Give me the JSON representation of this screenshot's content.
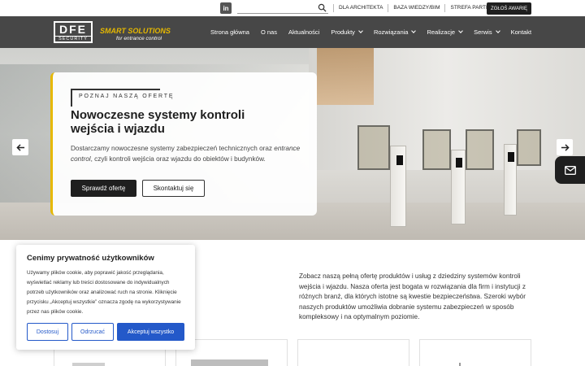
{
  "topbar": {
    "linkedin_label": "in",
    "search_placeholder": "",
    "links": [
      "DLA ARCHITEKTA",
      "BAZA WIEDZY/BIM",
      "STREFA PARTNERA"
    ],
    "report_button": "ZGŁOŚ AWARIĘ"
  },
  "header": {
    "logo_main": "DFE",
    "logo_sub": "SECURITY",
    "tagline_main": "SMART SOLUTIONS",
    "tagline_sub": "for entrance control",
    "menu": [
      {
        "label": "Strona główna",
        "dropdown": false
      },
      {
        "label": "O nas",
        "dropdown": false
      },
      {
        "label": "Aktualności",
        "dropdown": false
      },
      {
        "label": "Produkty",
        "dropdown": true
      },
      {
        "label": "Rozwiązania",
        "dropdown": true
      },
      {
        "label": "Realizacje",
        "dropdown": true
      },
      {
        "label": "Serwis",
        "dropdown": true
      },
      {
        "label": "Kontakt",
        "dropdown": false
      }
    ]
  },
  "hero": {
    "eyebrow": "POZNAJ NASZĄ OFERTĘ",
    "title": "Nowoczesne systemy kontroli wejścia i wjazdu",
    "desc_before": "Dostarczamy nowoczesne systemy zabezpieczeń technicznych oraz ",
    "desc_italic": "entrance control",
    "desc_after": ", czyli kontroli wejścia oraz wjazdu do obiektów i budynków.",
    "primary_button": "Sprawdź ofertę",
    "secondary_button": "Skontaktuj się"
  },
  "offer": {
    "text": "Zobacz naszą pełną ofertę produktów i usług z dziedziny systemów kontroli wejścia i wjazdu. Nasza oferta jest bogata w rozwiązania dla firm i instytucji z różnych branż, dla których istotne są kwestie bezpieczeństwa. Szeroki wybór naszych produktów umożliwia dobranie systemu zabezpieczeń w sposób kompleksowy i na optymalnym poziomie."
  },
  "cookie": {
    "title": "Cenimy prywatność użytkowników",
    "text": "Używamy plików cookie, aby poprawić jakość przeglądania, wyświetlać reklamy lub treści dostosowane do indywidualnych potrzeb użytkowników oraz analizować ruch na stronie. Kliknięcie przycisku „Akceptuj wszystkie” oznacza zgodę na wykorzystywanie przez nas plików cookie.",
    "customize": "Dostosuj",
    "reject": "Odrzucać",
    "accept": "Akceptuj wszystko"
  },
  "colors": {
    "accent": "#e6b800",
    "nav_bg": "#474747",
    "cookie_blue": "#2459c9",
    "dark_button": "#1f1f1f"
  },
  "icons": [
    "linkedin-icon",
    "search-icon",
    "chevron-down-icon",
    "arrow-left-icon",
    "arrow-right-icon",
    "mail-icon"
  ]
}
